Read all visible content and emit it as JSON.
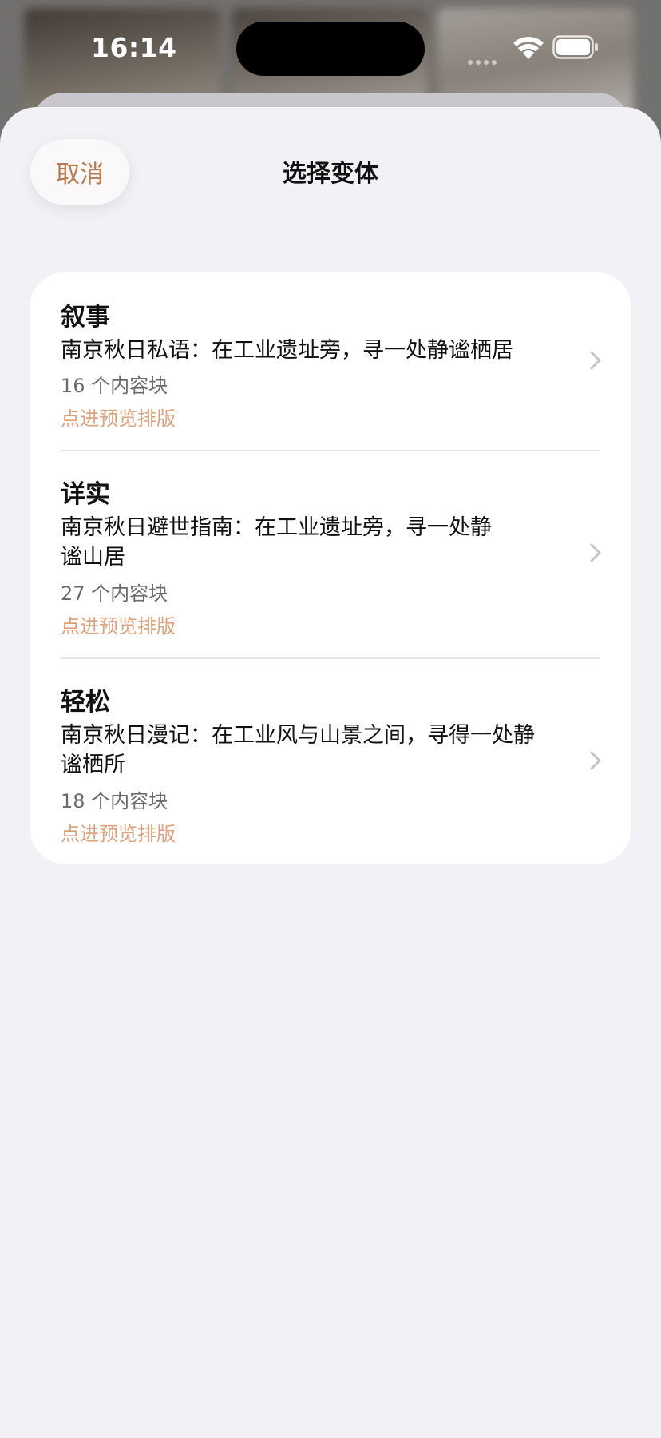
{
  "status_bar": {
    "time": "16:14"
  },
  "sheet": {
    "cancel_label": "取消",
    "title": "选择变体"
  },
  "variants": [
    {
      "style": "叙事",
      "headline": "南京秋日私语：在工业遗址旁，寻一处静谧栖居",
      "block_count": "16 个内容块",
      "preview_hint": "点进预览排版"
    },
    {
      "style": "详实",
      "headline": "南京秋日避世指南：在工业遗址旁，寻一处静谧山居",
      "block_count": "27 个内容块",
      "preview_hint": "点进预览排版"
    },
    {
      "style": "轻松",
      "headline": "南京秋日漫记：在工业风与山景之间，寻得一处静谧栖所",
      "block_count": "18 个内容块",
      "preview_hint": "点进预览排版"
    }
  ],
  "colors": {
    "accent": "#b9784e",
    "hint": "#dfa27c",
    "sheet_background": "#f2f1f6",
    "card_background": "#ffffff"
  },
  "icons": {
    "row_disclosure": "chevron-right-icon",
    "wifi": "wifi-icon",
    "battery": "battery-icon"
  }
}
